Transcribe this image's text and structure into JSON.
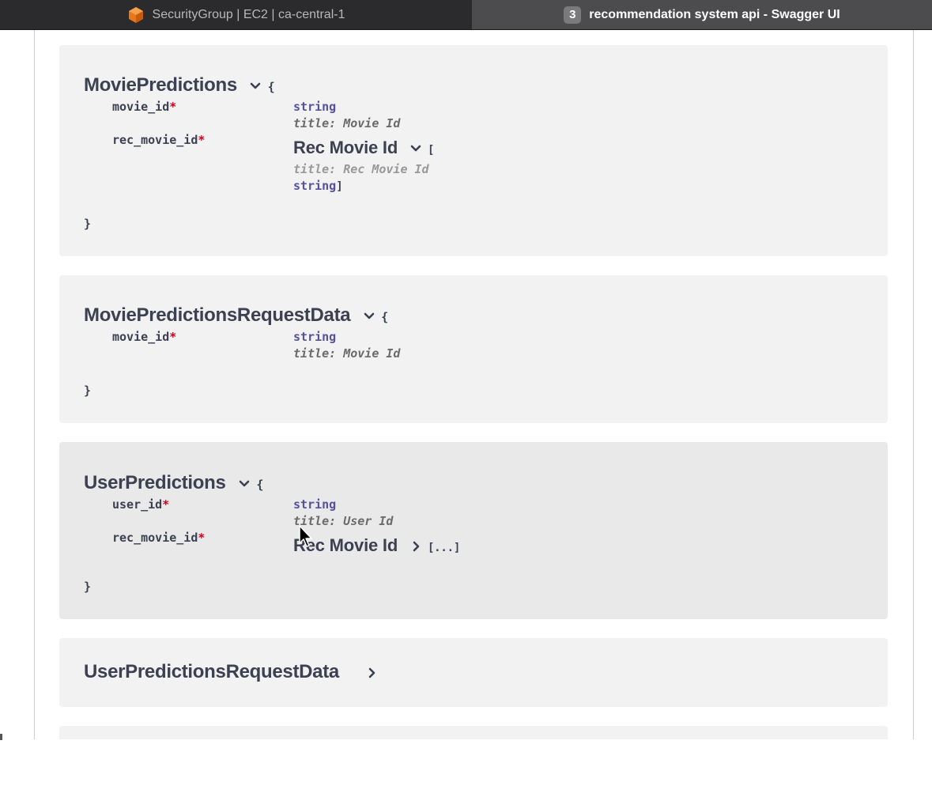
{
  "browser": {
    "tabs": [
      {
        "label": "SecurityGroup | EC2 | ca-central-1",
        "icon": "aws-ec2-cube-icon",
        "active": false
      },
      {
        "label": "recommendation system api - Swagger UI",
        "badge": "3",
        "active": true
      }
    ]
  },
  "schemas": {
    "movie_predictions": {
      "name": "MoviePredictions",
      "open_brace": "{",
      "close_brace": "}",
      "props": [
        {
          "name": "movie_id",
          "required": "*",
          "type": "string",
          "title": "title: Movie Id"
        },
        {
          "name": "rec_movie_id",
          "required": "*",
          "array_title": "Rec Movie Id",
          "open_bracket": "[",
          "item_title": "title: Rec Movie Id",
          "item_type": "string",
          "close_bracket": "]"
        }
      ]
    },
    "movie_predictions_request": {
      "name": "MoviePredictionsRequestData",
      "open_brace": "{",
      "close_brace": "}",
      "props": [
        {
          "name": "movie_id",
          "required": "*",
          "type": "string",
          "title": "title: Movie Id"
        }
      ]
    },
    "user_predictions": {
      "name": "UserPredictions",
      "open_brace": "{",
      "close_brace": "}",
      "props": [
        {
          "name": "user_id",
          "required": "*",
          "type": "string",
          "title": "title: User Id"
        },
        {
          "name": "rec_movie_id",
          "required": "*",
          "array_title": "Rec Movie Id",
          "collapsed": "[...]"
        }
      ]
    },
    "user_predictions_request": {
      "name": "UserPredictionsRequestData"
    }
  },
  "colors": {
    "panel": "#f2f2f2",
    "panel_hover": "#e9e9e9",
    "type": "#55519e",
    "required": "#d0021b",
    "title_text": "#3b4151"
  }
}
